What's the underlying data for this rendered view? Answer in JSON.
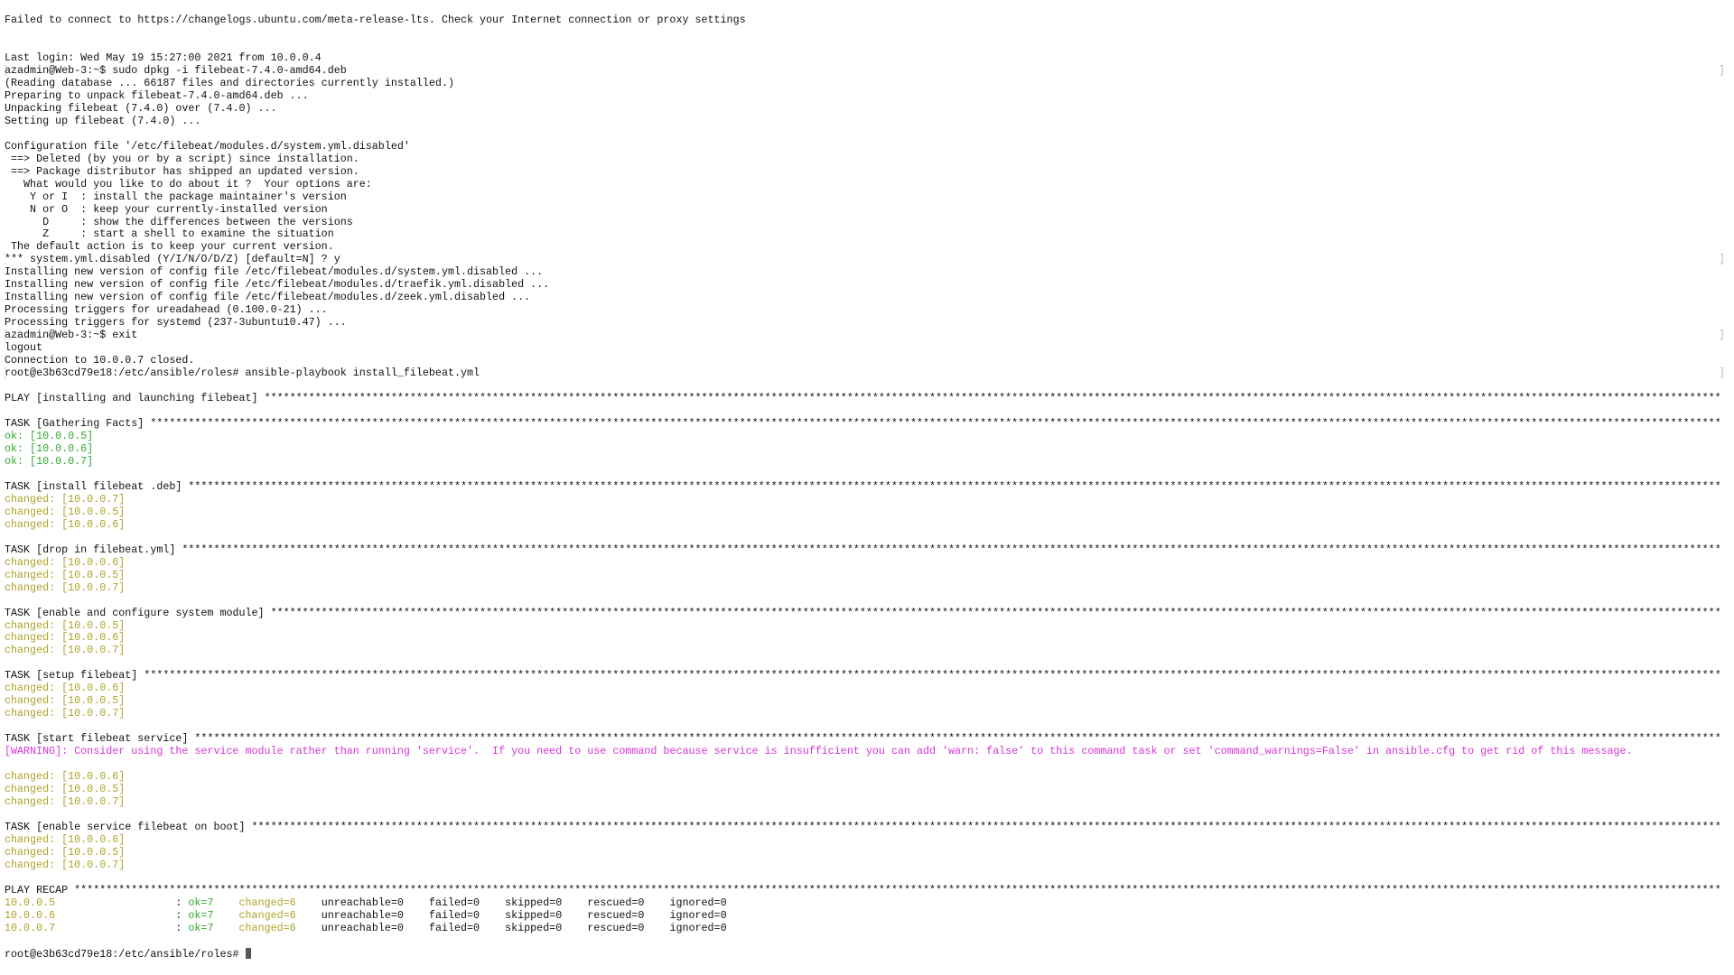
{
  "window": {
    "type": "terminal"
  },
  "colors": {
    "ok": "#2faa2f",
    "changed": "#ada329",
    "warn": "#d633d6",
    "text": "#111111"
  },
  "fill_char": "*",
  "lines": [
    {
      "segs": [
        {
          "t": "Failed to connect to https://changelogs.ubuntu.com/meta-release-lts. Check your Internet connection or proxy settings"
        }
      ]
    },
    {
      "segs": []
    },
    {
      "segs": []
    },
    {
      "segs": [
        {
          "t": "Last login: Wed May 19 15:27:00 2021 from 10.0.0.4"
        }
      ]
    },
    {
      "mark": true,
      "segs": [
        {
          "t": "azadmin@Web-3:~$ sudo dpkg -i filebeat-7.4.0-amd64.deb"
        }
      ]
    },
    {
      "segs": [
        {
          "t": "(Reading database ... 66187 files and directories currently installed.)"
        }
      ]
    },
    {
      "segs": [
        {
          "t": "Preparing to unpack filebeat-7.4.0-amd64.deb ..."
        }
      ]
    },
    {
      "segs": [
        {
          "t": "Unpacking filebeat (7.4.0) over (7.4.0) ..."
        }
      ]
    },
    {
      "segs": [
        {
          "t": "Setting up filebeat (7.4.0) ..."
        }
      ]
    },
    {
      "segs": []
    },
    {
      "segs": [
        {
          "t": "Configuration file '/etc/filebeat/modules.d/system.yml.disabled'"
        }
      ]
    },
    {
      "segs": [
        {
          "t": " ==> Deleted (by you or by a script) since installation."
        }
      ]
    },
    {
      "segs": [
        {
          "t": " ==> Package distributor has shipped an updated version."
        }
      ]
    },
    {
      "segs": [
        {
          "t": "   What would you like to do about it ?  Your options are:"
        }
      ]
    },
    {
      "segs": [
        {
          "t": "    Y or I  : install the package maintainer's version"
        }
      ]
    },
    {
      "segs": [
        {
          "t": "    N or O  : keep your currently-installed version"
        }
      ]
    },
    {
      "segs": [
        {
          "t": "      D     : show the differences between the versions"
        }
      ]
    },
    {
      "segs": [
        {
          "t": "      Z     : start a shell to examine the situation"
        }
      ]
    },
    {
      "segs": [
        {
          "t": " The default action is to keep your current version."
        }
      ]
    },
    {
      "mark": true,
      "segs": [
        {
          "t": "*** system.yml.disabled (Y/I/N/O/D/Z) [default=N] ? y"
        }
      ]
    },
    {
      "segs": [
        {
          "t": "Installing new version of config file /etc/filebeat/modules.d/system.yml.disabled ..."
        }
      ]
    },
    {
      "segs": [
        {
          "t": "Installing new version of config file /etc/filebeat/modules.d/traefik.yml.disabled ..."
        }
      ]
    },
    {
      "segs": [
        {
          "t": "Installing new version of config file /etc/filebeat/modules.d/zeek.yml.disabled ..."
        }
      ]
    },
    {
      "segs": [
        {
          "t": "Processing triggers for ureadahead (0.100.0-21) ..."
        }
      ]
    },
    {
      "segs": [
        {
          "t": "Processing triggers for systemd (237-3ubuntu10.47) ..."
        }
      ]
    },
    {
      "mark": true,
      "segs": [
        {
          "t": "azadmin@Web-3:~$ exit"
        }
      ]
    },
    {
      "segs": [
        {
          "t": "logout"
        }
      ]
    },
    {
      "segs": [
        {
          "t": "Connection to 10.0.0.7 closed."
        }
      ]
    },
    {
      "mark": true,
      "segs": [
        {
          "t": "root@e3b63cd79e18:/etc/ansible/roles# ansible-playbook install_filebeat.yml"
        }
      ]
    },
    {
      "segs": []
    },
    {
      "fill": true,
      "segs": [
        {
          "t": "PLAY [installing and launching filebeat] "
        }
      ]
    },
    {
      "segs": []
    },
    {
      "fill": true,
      "segs": [
        {
          "t": "TASK [Gathering Facts] "
        }
      ]
    },
    {
      "segs": [
        {
          "t": "ok: [10.0.0.5]",
          "c": "ok"
        }
      ]
    },
    {
      "segs": [
        {
          "t": "ok: [10.0.0.6]",
          "c": "ok"
        }
      ]
    },
    {
      "segs": [
        {
          "t": "ok: [10.0.0.7]",
          "c": "ok"
        }
      ]
    },
    {
      "segs": []
    },
    {
      "fill": true,
      "segs": [
        {
          "t": "TASK [install filebeat .deb] "
        }
      ]
    },
    {
      "segs": [
        {
          "t": "changed: [10.0.0.7]",
          "c": "changed"
        }
      ]
    },
    {
      "segs": [
        {
          "t": "changed: [10.0.0.5]",
          "c": "changed"
        }
      ]
    },
    {
      "segs": [
        {
          "t": "changed: [10.0.0.6]",
          "c": "changed"
        }
      ]
    },
    {
      "segs": []
    },
    {
      "fill": true,
      "segs": [
        {
          "t": "TASK [drop in filebeat.yml] "
        }
      ]
    },
    {
      "segs": [
        {
          "t": "changed: [10.0.0.6]",
          "c": "changed"
        }
      ]
    },
    {
      "segs": [
        {
          "t": "changed: [10.0.0.5]",
          "c": "changed"
        }
      ]
    },
    {
      "segs": [
        {
          "t": "changed: [10.0.0.7]",
          "c": "changed"
        }
      ]
    },
    {
      "segs": []
    },
    {
      "fill": true,
      "segs": [
        {
          "t": "TASK [enable and configure system module] "
        }
      ]
    },
    {
      "segs": [
        {
          "t": "changed: [10.0.0.5]",
          "c": "changed"
        }
      ]
    },
    {
      "segs": [
        {
          "t": "changed: [10.0.0.6]",
          "c": "changed"
        }
      ]
    },
    {
      "segs": [
        {
          "t": "changed: [10.0.0.7]",
          "c": "changed"
        }
      ]
    },
    {
      "segs": []
    },
    {
      "fill": true,
      "segs": [
        {
          "t": "TASK [setup filebeat] "
        }
      ]
    },
    {
      "segs": [
        {
          "t": "changed: [10.0.0.6]",
          "c": "changed"
        }
      ]
    },
    {
      "segs": [
        {
          "t": "changed: [10.0.0.5]",
          "c": "changed"
        }
      ]
    },
    {
      "segs": [
        {
          "t": "changed: [10.0.0.7]",
          "c": "changed"
        }
      ]
    },
    {
      "segs": []
    },
    {
      "fill": true,
      "segs": [
        {
          "t": "TASK [start filebeat service] "
        }
      ]
    },
    {
      "segs": [
        {
          "t": "[WARNING]: Consider using the service module rather than running 'service'.  If you need to use command because service is insufficient you can add 'warn: false' to this command task or set 'command_warnings=False' in ansible.cfg to get rid of this message.",
          "c": "warn"
        }
      ]
    },
    {
      "segs": []
    },
    {
      "segs": [
        {
          "t": "changed: [10.0.0.6]",
          "c": "changed"
        }
      ]
    },
    {
      "segs": [
        {
          "t": "changed: [10.0.0.5]",
          "c": "changed"
        }
      ]
    },
    {
      "segs": [
        {
          "t": "changed: [10.0.0.7]",
          "c": "changed"
        }
      ]
    },
    {
      "segs": []
    },
    {
      "fill": true,
      "segs": [
        {
          "t": "TASK [enable service filebeat on boot] "
        }
      ]
    },
    {
      "segs": [
        {
          "t": "changed: [10.0.0.6]",
          "c": "changed"
        }
      ]
    },
    {
      "segs": [
        {
          "t": "changed: [10.0.0.5]",
          "c": "changed"
        }
      ]
    },
    {
      "segs": [
        {
          "t": "changed: [10.0.0.7]",
          "c": "changed"
        }
      ]
    },
    {
      "segs": []
    },
    {
      "fill": true,
      "segs": [
        {
          "t": "PLAY RECAP "
        }
      ]
    },
    {
      "segs": [
        {
          "t": "10.0.0.5                   ",
          "c": "changed"
        },
        {
          "t": ": "
        },
        {
          "t": "ok=7",
          "c": "ok"
        },
        {
          "t": "    "
        },
        {
          "t": "changed=6",
          "c": "changed"
        },
        {
          "t": "    unreachable=0    failed=0    skipped=0    rescued=0    ignored=0"
        }
      ]
    },
    {
      "segs": [
        {
          "t": "10.0.0.6                   ",
          "c": "changed"
        },
        {
          "t": ": "
        },
        {
          "t": "ok=7",
          "c": "ok"
        },
        {
          "t": "    "
        },
        {
          "t": "changed=6",
          "c": "changed"
        },
        {
          "t": "    unreachable=0    failed=0    skipped=0    rescued=0    ignored=0"
        }
      ]
    },
    {
      "segs": [
        {
          "t": "10.0.0.7                   ",
          "c": "changed"
        },
        {
          "t": ": "
        },
        {
          "t": "ok=7",
          "c": "ok"
        },
        {
          "t": "    "
        },
        {
          "t": "changed=6",
          "c": "changed"
        },
        {
          "t": "    unreachable=0    failed=0    skipped=0    rescued=0    ignored=0"
        }
      ]
    },
    {
      "segs": []
    },
    {
      "cursor": true,
      "segs": [
        {
          "t": "root@e3b63cd79e18:/etc/ansible/roles# "
        }
      ]
    }
  ]
}
